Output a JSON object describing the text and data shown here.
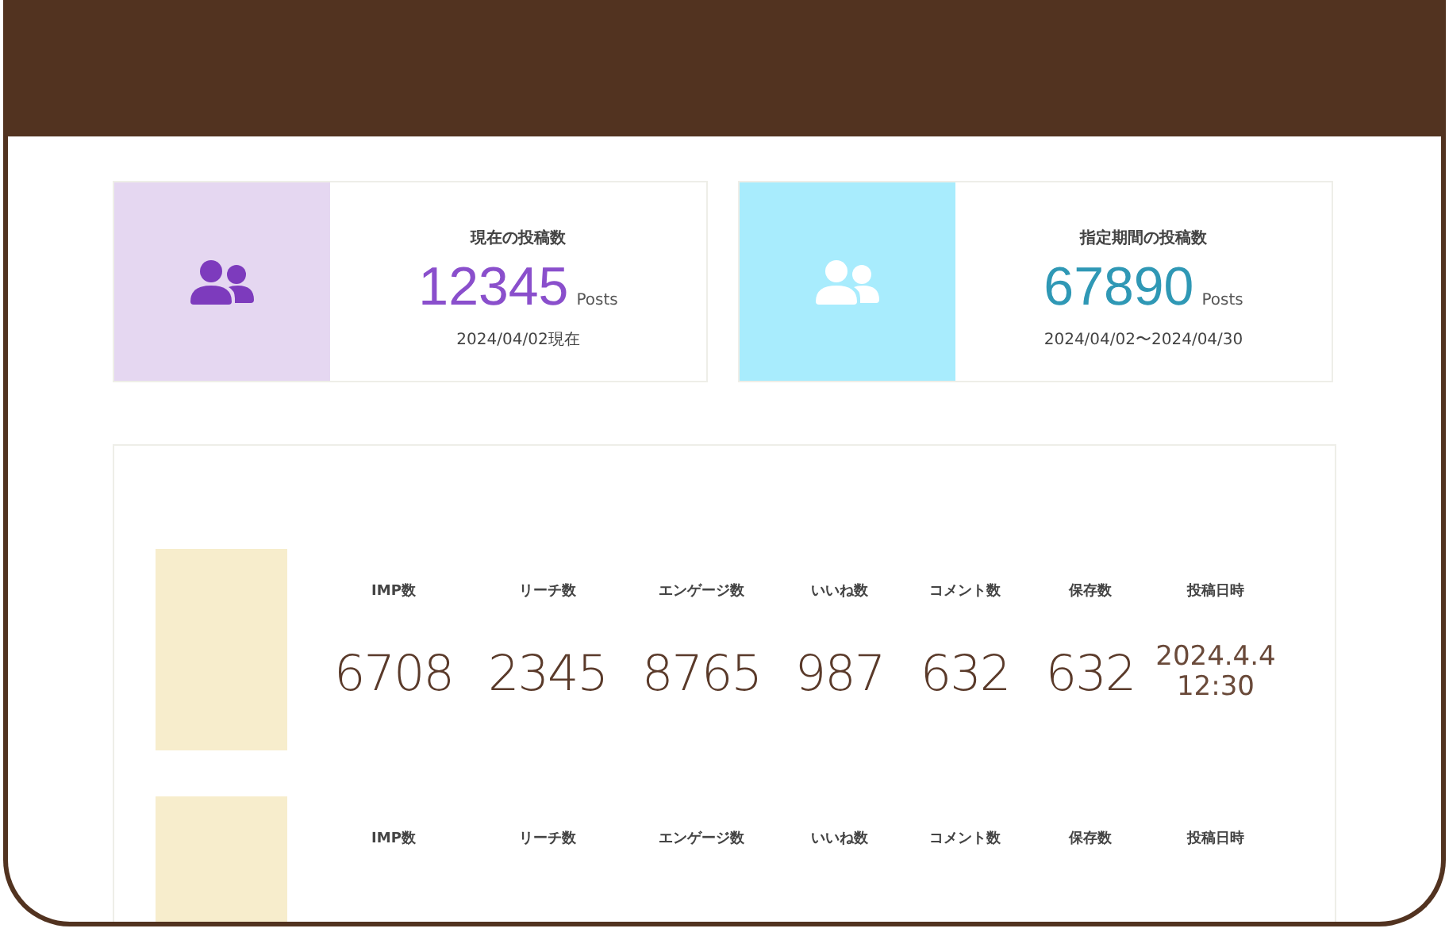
{
  "summary_cards": [
    {
      "kind": "current",
      "title": "現在の投稿数",
      "value": "12345",
      "unit": "Posts",
      "note": "2024/04/02現在"
    },
    {
      "kind": "period",
      "title": "指定期間の投稿数",
      "value": "67890",
      "unit": "Posts",
      "note": "2024/04/02〜2024/04/30"
    }
  ],
  "posts": [
    {
      "columns": [
        "IMP数",
        "リーチ数",
        "エンゲージ数",
        "いいね数",
        "コメント数",
        "保存数",
        "投稿日時"
      ],
      "values": [
        "6708",
        "2345",
        "8765",
        "987",
        "632",
        "632"
      ],
      "date": "2024.4.4",
      "time": "12:30"
    },
    {
      "columns": [
        "IMP数",
        "リーチ数",
        "エンゲージ数",
        "いいね数",
        "コメント数",
        "保存数",
        "投稿日時"
      ]
    }
  ]
}
